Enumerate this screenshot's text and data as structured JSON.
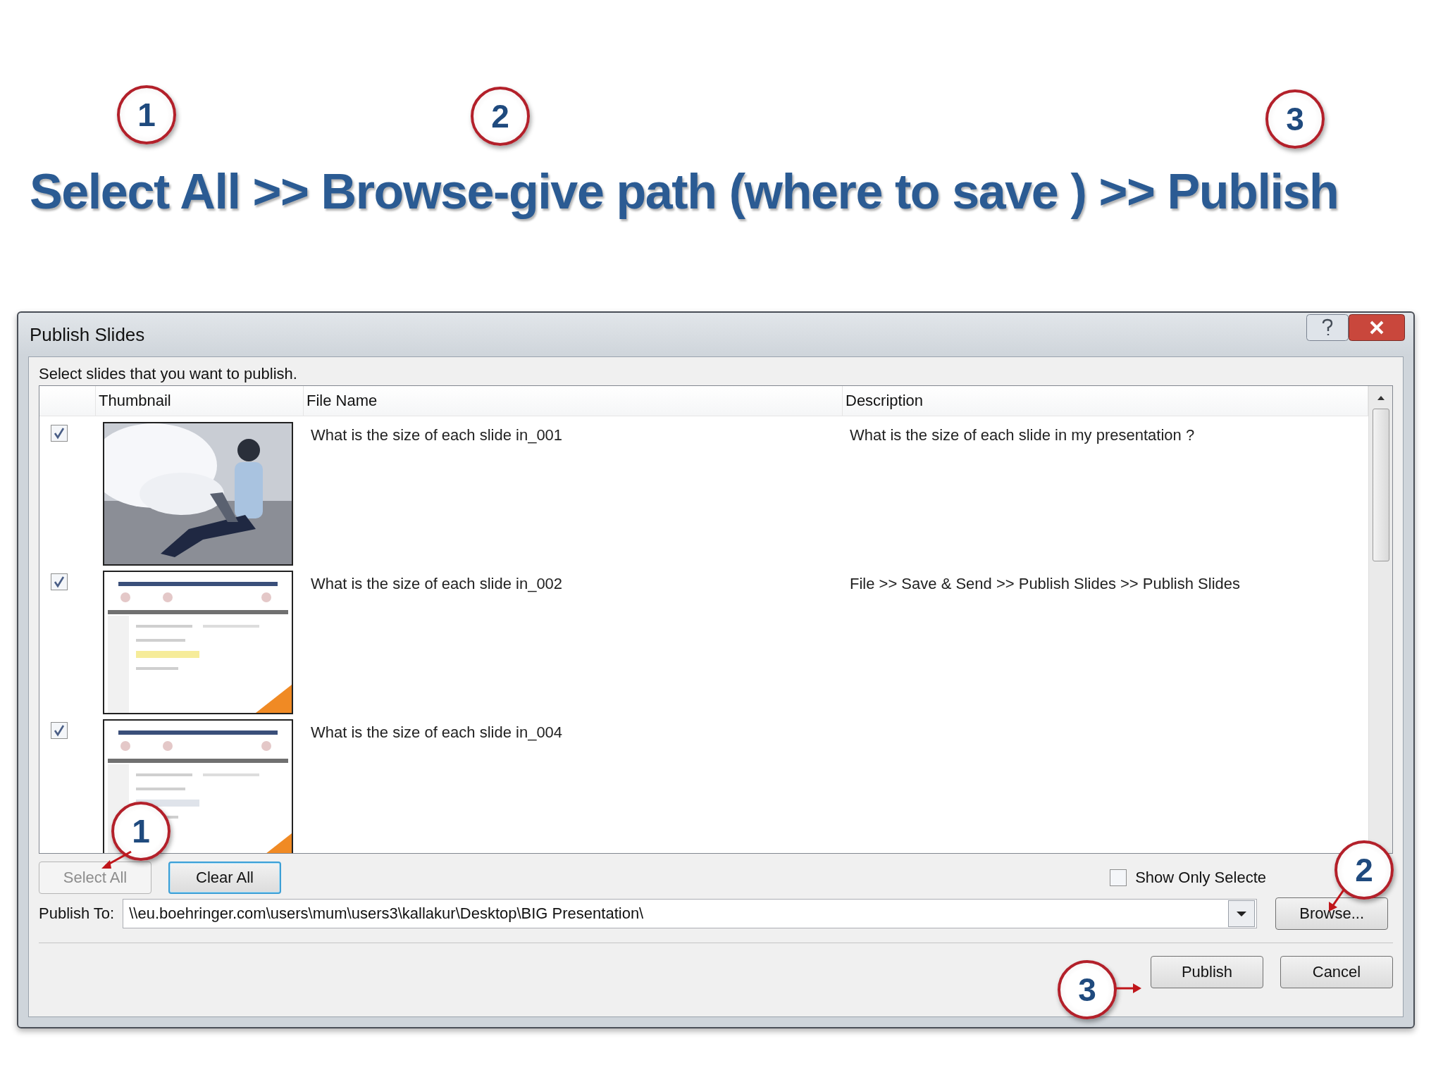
{
  "steps": [
    {
      "number": "1"
    },
    {
      "number": "2"
    },
    {
      "number": "3"
    }
  ],
  "heading": "Select All >> Browse-give path (where to save ) >> Publish",
  "dialog": {
    "title": "Publish Slides",
    "instruction": "Select slides that you want to publish.",
    "columns": [
      "Thumbnail",
      "File Name",
      "Description"
    ],
    "rows": [
      {
        "checked": true,
        "file_name": "What is the size of each slide in_001",
        "description": "What is the size of each slide in my presentation ?"
      },
      {
        "checked": true,
        "file_name": "What is the size of each slide in_002",
        "description": "File >> Save & Send >> Publish Slides >> Publish Slides"
      },
      {
        "checked": true,
        "file_name": "What is the size of each slide in_004"
      }
    ],
    "select_all": {
      "label": "Select All",
      "disabled": true
    },
    "clear_all": {
      "label": "Clear All",
      "disabled": false
    },
    "show_only_selected": {
      "label": "Show Only Selecte",
      "checked": false
    },
    "publish_to": {
      "label": "Publish To:",
      "value": "\\\\eu.boehringer.com\\users\\mum\\users3\\kallakur\\Desktop\\BIG Presentation\\"
    },
    "browse": "Browse...",
    "publish": "Publish",
    "cancel": "Cancel"
  },
  "callouts": [
    {
      "number": "1"
    },
    {
      "number": "2"
    },
    {
      "number": "3"
    }
  ]
}
